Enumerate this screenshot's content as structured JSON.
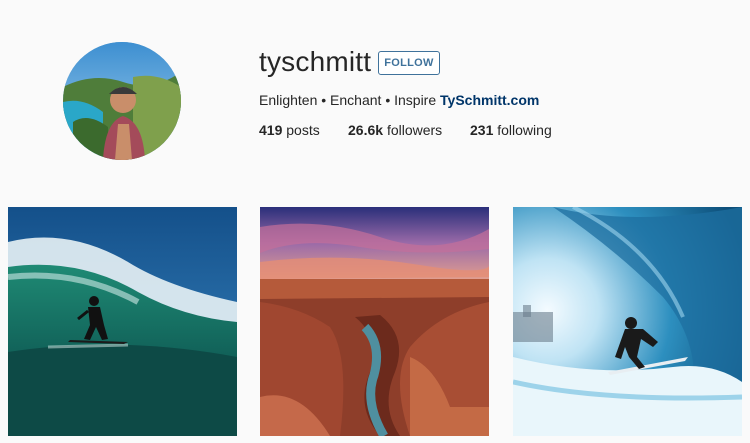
{
  "profile": {
    "username": "tyschmitt",
    "follow_label": "FOLLOW",
    "bio_text": "Enlighten • Enchant • Inspire",
    "bio_link": "TySchmitt.com",
    "stats": {
      "posts_count": "419",
      "posts_label": "posts",
      "followers_count": "26.6k",
      "followers_label": "followers",
      "following_count": "231",
      "following_label": "following"
    }
  },
  "colors": {
    "follow_accent": "#3f729b",
    "link": "#003569",
    "background": "#fafafa"
  },
  "posts": [
    {
      "subject": "surfer-on-green-wave"
    },
    {
      "subject": "canyon-river-sunset"
    },
    {
      "subject": "surfer-in-blue-barrel"
    }
  ]
}
